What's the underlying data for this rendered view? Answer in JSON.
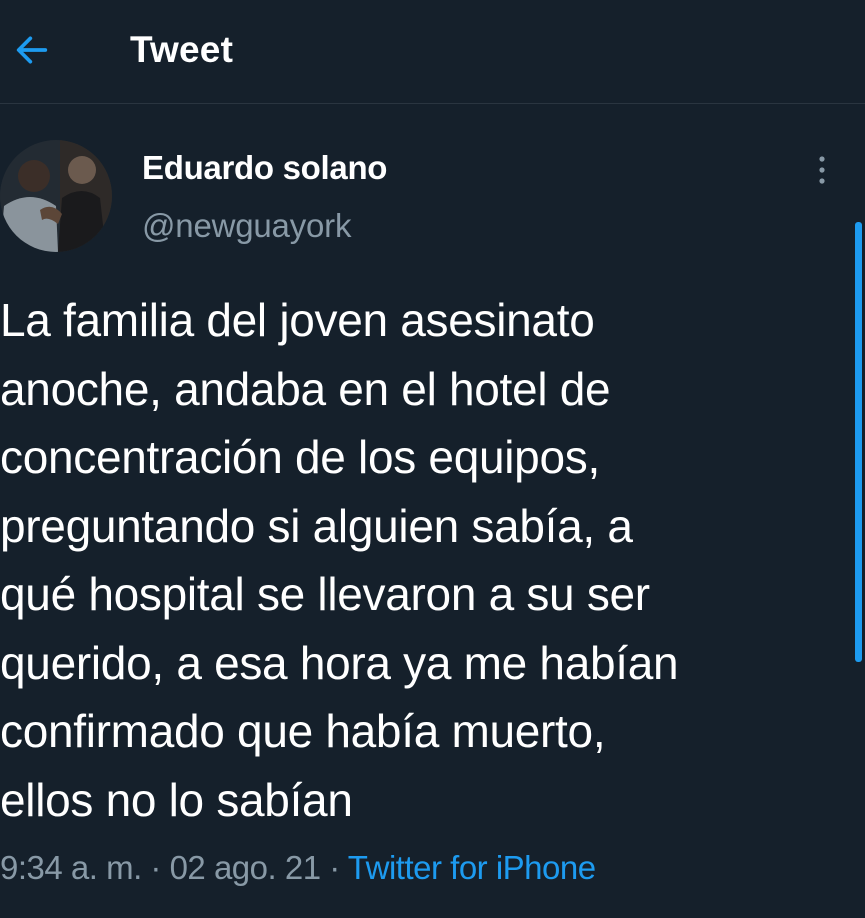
{
  "header": {
    "back_icon": "back-arrow-icon",
    "title": "Tweet"
  },
  "author": {
    "display_name": "Eduardo solano",
    "handle": "@newguayork",
    "avatar": "profile-photo"
  },
  "more_icon": "more-vertical-icon",
  "tweet": {
    "text": "La familia del joven asesinato\nanoche, andaba en el hotel de\nconcentración de los equipos,\npreguntando si alguien sabía, a\nqué hospital se llevaron a su ser\nquerido, a esa hora ya me habían\nconfirmado que había muerto,\nellos no lo sabían",
    "time": "9:34 a. m.",
    "separator": " · ",
    "date": "02 ago. 21",
    "source": "Twitter for iPhone"
  },
  "colors": {
    "background": "#15202b",
    "accent": "#1d9bf0",
    "secondary_text": "#8899a6",
    "primary_text": "#ffffff"
  }
}
